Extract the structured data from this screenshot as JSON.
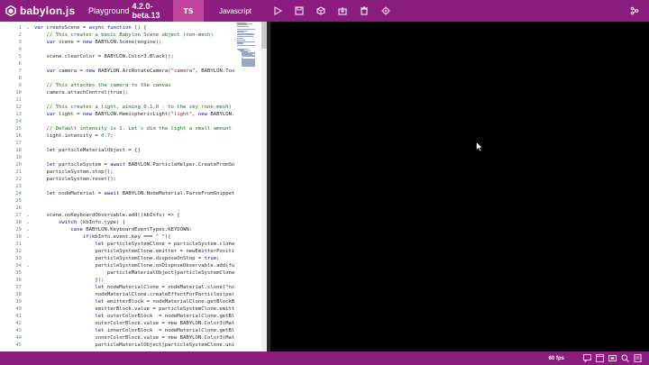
{
  "app": {
    "name": "babylon.js",
    "title_prefix": "Playground",
    "version": "4.2.0-beta.13"
  },
  "toolbar": {
    "lang_ts": "TS",
    "lang_js": "Javascript",
    "icons": [
      "play-icon",
      "save-icon",
      "inspector-icon",
      "download-icon",
      "delete-icon",
      "settings-icon"
    ],
    "right_icon": "examples-icon"
  },
  "editor": {
    "lines": [
      {
        "n": "1",
        "fold": "v",
        "text": "var createScene = async function () {"
      },
      {
        "n": "2",
        "text": "    // This creates a basic Babylon Scene object (non-mesh)"
      },
      {
        "n": "3",
        "text": "    var scene = new BABYLON.Scene(engine);"
      },
      {
        "n": "4",
        "text": ""
      },
      {
        "n": "5",
        "text": "    scene.clearColor = BABYLON.Color3.Black();"
      },
      {
        "n": "6",
        "text": ""
      },
      {
        "n": "7",
        "text": "    var camera = new BABYLON.ArcRotateCamera(\"camera\", BABYLON.Tools.T"
      },
      {
        "n": "8",
        "text": ""
      },
      {
        "n": "9",
        "text": "    // This attaches the camera to the canvas"
      },
      {
        "n": "10",
        "text": "    camera.attachControl(true);"
      },
      {
        "n": "11",
        "text": ""
      },
      {
        "n": "12",
        "text": "    // This creates a light, aiming 0,1,0 - to the sky (non-mesh)"
      },
      {
        "n": "13",
        "text": "    var light = new BABYLON.HemisphericLight(\"light\", new BABYLON.Vect"
      },
      {
        "n": "14",
        "text": ""
      },
      {
        "n": "15",
        "text": "    // Default intensity is 1. Let's dim the light a small amount"
      },
      {
        "n": "16",
        "text": "    light.intensity = 0.7;"
      },
      {
        "n": "17",
        "text": ""
      },
      {
        "n": "18",
        "text": "    let particleMaterialObject = {}"
      },
      {
        "n": "19",
        "text": ""
      },
      {
        "n": "20",
        "text": "    let particleSystem = await BABYLON.ParticleHelper.CreateFromSnippet"
      },
      {
        "n": "21",
        "text": "    particleSystem.stop();"
      },
      {
        "n": "22",
        "text": "    particleSystem.reset();"
      },
      {
        "n": "23",
        "text": ""
      },
      {
        "n": "24",
        "text": "    let nodeMaterial = await BABYLON.NodeMaterial.ParseFromSnippetAsyn"
      },
      {
        "n": "25",
        "text": ""
      },
      {
        "n": "26",
        "text": ""
      },
      {
        "n": "27",
        "fold": "v",
        "text": "    scene.onKeyboardObservable.add((kbInfo) => {"
      },
      {
        "n": "28",
        "fold": "v",
        "text": "        switch (kbInfo.type) {"
      },
      {
        "n": "29",
        "fold": "v",
        "text": "            case BABYLON.KeyboardEventTypes.KEYDOWN:"
      },
      {
        "n": "30",
        "fold": "v",
        "text": "                if(kbInfo.event.key === \" \"){"
      },
      {
        "n": "31",
        "text": "                    let particleSystemClone = particleSystem.clone(\"pa"
      },
      {
        "n": "32",
        "text": "                    particleSystemClone.emitter = newEmitterPosition()"
      },
      {
        "n": "33",
        "text": "                    particleSystemClone.disposeOnStop = true;"
      },
      {
        "n": "34",
        "fold": "v",
        "text": "                    particleSystemClone.onDisposeObservable.add(functi"
      },
      {
        "n": "35",
        "text": "                        particleMaterialObject[particleSystemClone.uni"
      },
      {
        "n": "36",
        "text": "                    });"
      },
      {
        "n": "37",
        "text": "                    let nodeMaterialClone = nodeMaterial.clone(\"nodeMa"
      },
      {
        "n": "38",
        "text": "                    nodeMaterialClone.createEffectForParticles(particl"
      },
      {
        "n": "39",
        "text": "                    let emitterBlock = nodeMaterialClone.getBlockByNam"
      },
      {
        "n": "40",
        "text": "                    emitterBlock.value = particleSystemClone.emitter;"
      },
      {
        "n": "41",
        "text": "                    let outerColorBlock  = nodeMaterialClone.getBlockB"
      },
      {
        "n": "42",
        "text": "                    outerColorBlock.value = new BABYLON.Color3(Math.ra"
      },
      {
        "n": "43",
        "text": "                    let innerColorBlock  = nodeMaterialClone.getBlockB"
      },
      {
        "n": "44",
        "text": "                    innerColorBlock.value = new BABYLON.Color3(Math.ra"
      },
      {
        "n": "45",
        "text": "                    particleMaterialObject[particleSystemClone.uniqueI"
      }
    ]
  },
  "footer": {
    "fps": "60 fps",
    "icons": [
      "debug-icon",
      "fullscreen-editor-icon",
      "fullscreen-icon",
      "zoom-icon",
      "metadata-icon"
    ]
  },
  "colors": {
    "brand": "#8b1d7f",
    "tab_active": "#c2459d",
    "keyword": "#0000ff",
    "comment": "#008000",
    "string": "#a31515"
  }
}
